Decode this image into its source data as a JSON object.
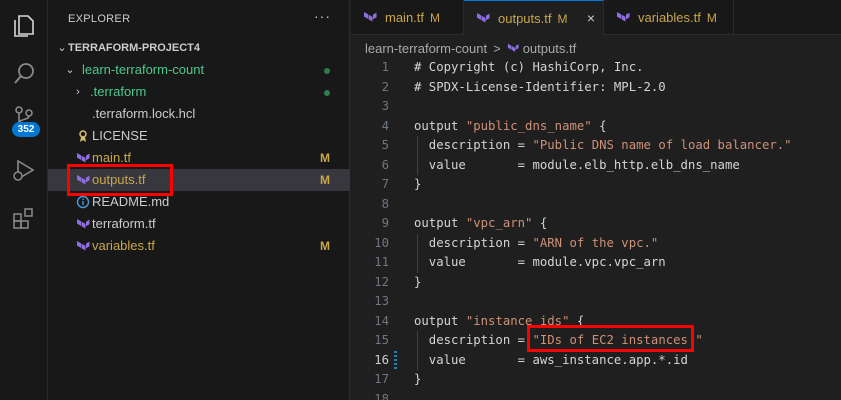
{
  "activity_bar": {
    "badge_count": "352",
    "icons": [
      "explorer-icon",
      "search-icon",
      "source-control-icon",
      "run-debug-icon",
      "extensions-icon"
    ]
  },
  "sidebar": {
    "header": "EXPLORER",
    "more_label": "···",
    "project": "TERRAFORM-PROJECT4",
    "items": [
      {
        "label": "learn-terraform-count",
        "kind": "folder-open",
        "color": "#4ec98a",
        "status": "dot"
      },
      {
        "label": ".terraform",
        "kind": "folder-closed",
        "color": "#4ec98a",
        "status": "dot"
      },
      {
        "label": ".terraform.lock.hcl",
        "kind": "file",
        "color": "#cccccc",
        "status": ""
      },
      {
        "label": "LICENSE",
        "kind": "license",
        "color": "#cccccc",
        "status": ""
      },
      {
        "label": "main.tf",
        "kind": "terraform",
        "color": "#c9a64a",
        "status": "M"
      },
      {
        "label": "outputs.tf",
        "kind": "terraform",
        "color": "#c9a64a",
        "status": "M"
      },
      {
        "label": "README.md",
        "kind": "info",
        "color": "#cccccc",
        "status": ""
      },
      {
        "label": "terraform.tf",
        "kind": "terraform",
        "color": "#cccccc",
        "status": ""
      },
      {
        "label": "variables.tf",
        "kind": "terraform",
        "color": "#c9a64a",
        "status": "M"
      }
    ]
  },
  "tabs": [
    {
      "label": "main.tf",
      "flag": "M",
      "active": false
    },
    {
      "label": "outputs.tf",
      "flag": "M",
      "active": true,
      "close": "×"
    },
    {
      "label": "variables.tf",
      "flag": "M",
      "active": false
    }
  ],
  "breadcrumb": {
    "folder": "learn-terraform-count",
    "separator": ">",
    "file": "outputs.tf"
  },
  "code": {
    "current_line": "16",
    "lines": [
      {
        "n": "1",
        "text": "# Copyright (c) HashiCorp, Inc."
      },
      {
        "n": "2",
        "text": "# SPDX-License-Identifier: MPL-2.0"
      },
      {
        "n": "3",
        "text": ""
      },
      {
        "n": "4",
        "text": "output \"public_dns_name\" {"
      },
      {
        "n": "5",
        "text": "  description = \"Public DNS name of load balancer.\""
      },
      {
        "n": "6",
        "text": "  value       = module.elb_http.elb_dns_name"
      },
      {
        "n": "7",
        "text": "}"
      },
      {
        "n": "8",
        "text": ""
      },
      {
        "n": "9",
        "text": "output \"vpc_arn\" {"
      },
      {
        "n": "10",
        "text": "  description = \"ARN of the vpc.\""
      },
      {
        "n": "11",
        "text": "  value       = module.vpc.vpc_arn"
      },
      {
        "n": "12",
        "text": "}"
      },
      {
        "n": "13",
        "text": ""
      },
      {
        "n": "14",
        "text": "output \"instance_ids\" {"
      },
      {
        "n": "15",
        "text": "  description = \"IDs of EC2 instances.\""
      },
      {
        "n": "16",
        "text": "  value       = aws_instance.app.*.id"
      },
      {
        "n": "17",
        "text": "}"
      },
      {
        "n": "18",
        "text": ""
      }
    ]
  },
  "colors": {
    "modified": "#c9a64a",
    "green": "#4ec98a",
    "accent": "#0078d4",
    "highlight": "#ff0000",
    "terraform": "#8f6ee0"
  }
}
